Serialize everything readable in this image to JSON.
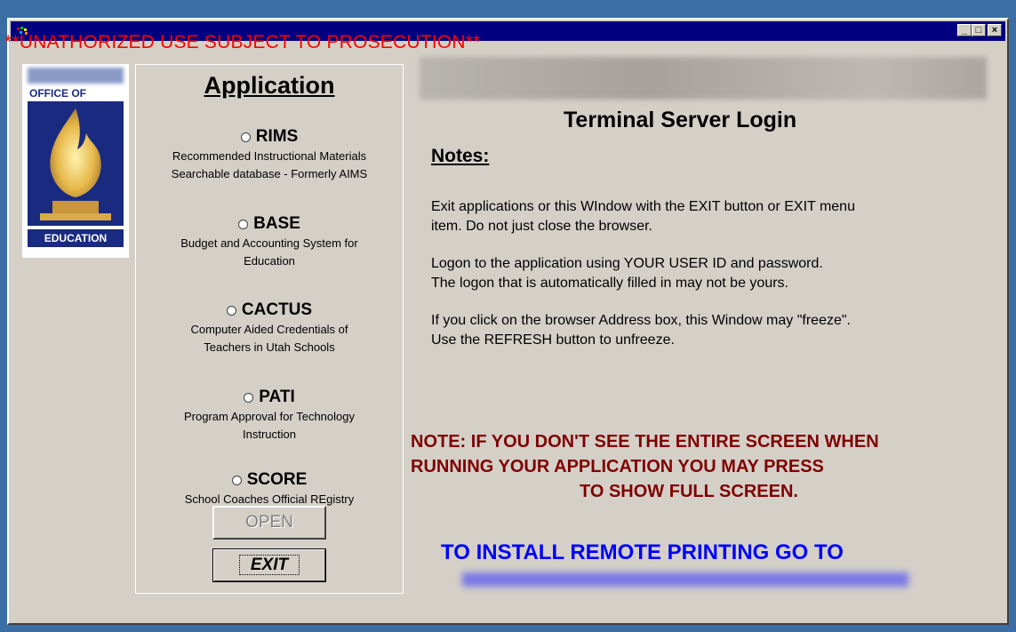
{
  "window": {
    "controls": {
      "minimize": "_",
      "maximize": "□",
      "close": "×"
    }
  },
  "warning": "**UNATHORIZED USE SUBJECT TO PROSECUTION**",
  "logo": {
    "top_text": "OFFICE OF",
    "bottom_text": "EDUCATION"
  },
  "applications": {
    "heading": "Application",
    "items": [
      {
        "name": "RIMS",
        "desc1": "Recommended Instructional Materials",
        "desc2": "Searchable database - Formerly AIMS"
      },
      {
        "name": "BASE",
        "desc1": "Budget and Accounting System for",
        "desc2": "Education"
      },
      {
        "name": "CACTUS",
        "desc1": "Computer Aided Credentials of",
        "desc2": "Teachers in Utah Schools"
      },
      {
        "name": "PATI",
        "desc1": "Program Approval for Technology",
        "desc2": "Instruction"
      },
      {
        "name": "SCORE",
        "desc1": "School Coaches Official REgistry",
        "desc2": ""
      }
    ],
    "open_label": "OPEN",
    "exit_label": "EXIT"
  },
  "main": {
    "title": "Terminal Server Login",
    "notes_heading": "Notes:",
    "notes": [
      {
        "line1": "Exit applications or this WIndow with the EXIT button or EXIT menu",
        "line2": "item.  Do not just close the browser."
      },
      {
        "line1": "Logon to the application using YOUR USER ID and password.",
        "line2": "The logon that is automatically filled in may not be yours."
      },
      {
        "line1": "If you click on the browser Address box, this Window may \"freeze\".",
        "line2": "Use the REFRESH button to unfreeze."
      }
    ],
    "red_note": {
      "line1": "NOTE: IF YOU DON'T SEE THE ENTIRE SCREEN WHEN",
      "line2": "RUNNING YOUR APPLICATION YOU MAY PRESS",
      "line3": "TO SHOW FULL SCREEN."
    },
    "printing_heading": "TO INSTALL REMOTE PRINTING GO TO"
  },
  "colors": {
    "title_bar": "#000080",
    "warning": "#ff0000",
    "red_note": "#800000",
    "printing": "#0000ff",
    "face": "#d4d0c8"
  }
}
